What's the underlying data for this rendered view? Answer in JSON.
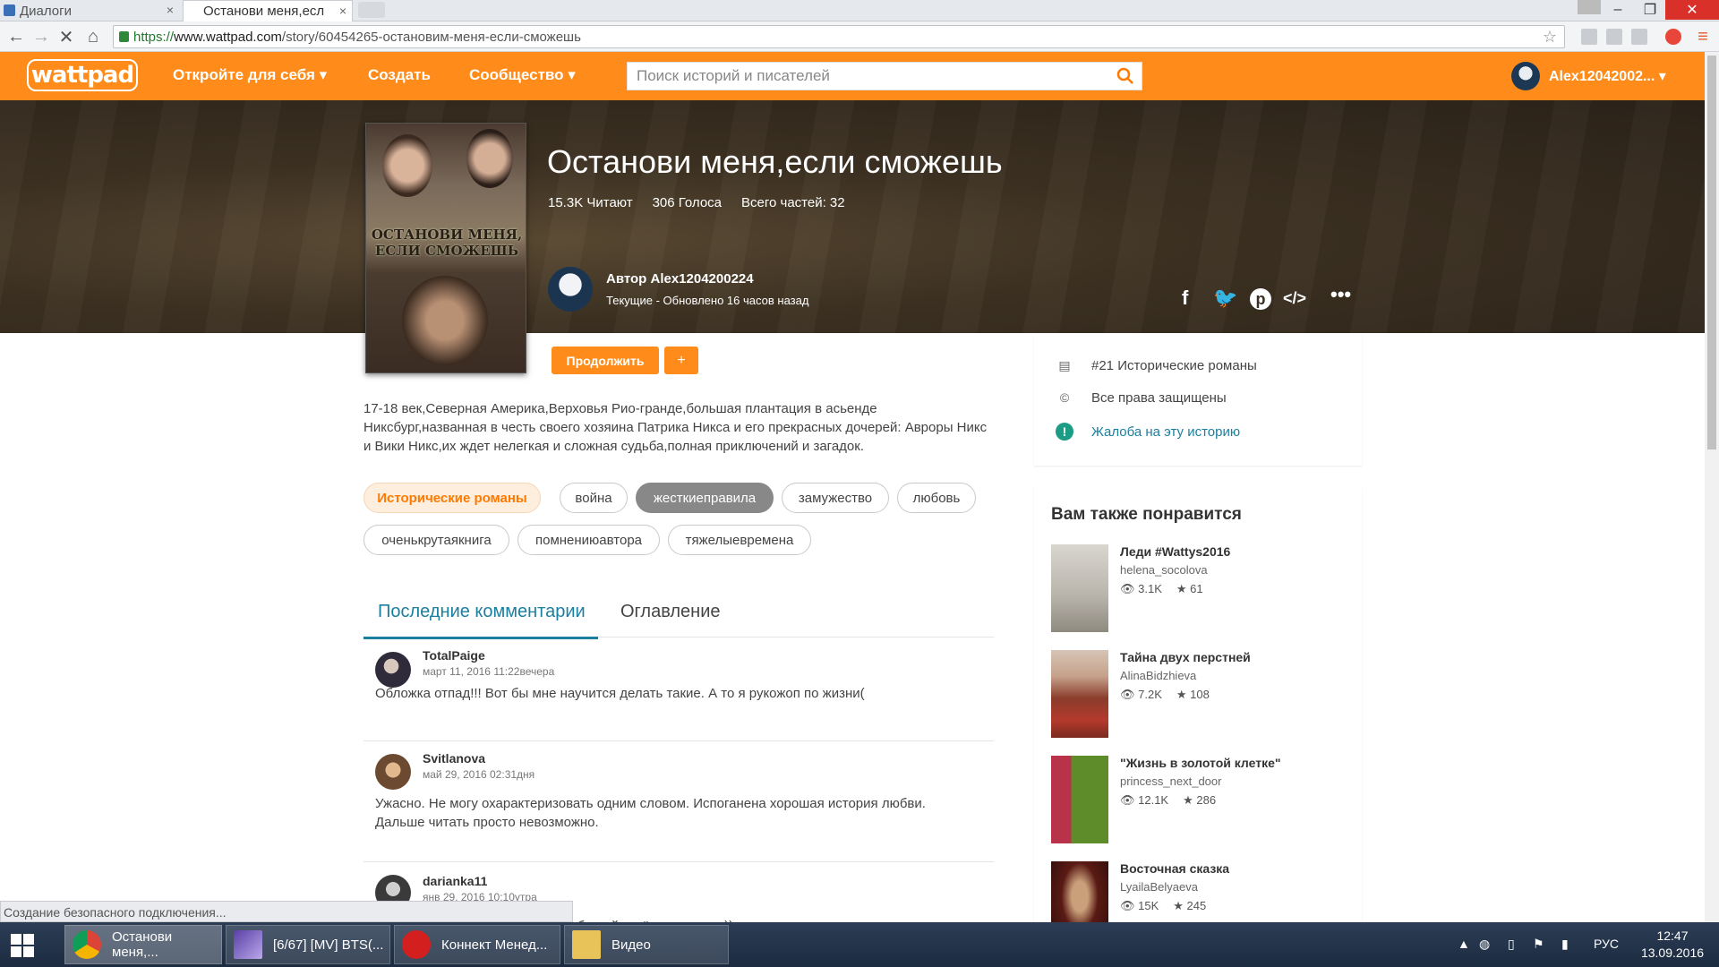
{
  "browser": {
    "tabs": [
      {
        "label": "Диалоги"
      },
      {
        "label": "Останови меня,есл"
      }
    ],
    "url_secure": "https://",
    "url_host": "www.wattpad.com",
    "url_path": "/story/60454265-остановим-меня-если-сможешь",
    "status_text": "Создание безопасного подключения..."
  },
  "nav": {
    "logo": "wattpad",
    "discover": "Откройте для себя ▾",
    "create": "Создать",
    "community": "Сообщество ▾",
    "search_placeholder": "Поиск историй и писателей",
    "username": "Alex12042002... ▾"
  },
  "story": {
    "cover_title": "ОСТАНОВИ МЕНЯ, ЕСЛИ СМОЖЕШЬ",
    "title": "Останови меня,если сможешь",
    "reads": "15.3K Читают",
    "votes": "306 Голоса",
    "parts": "Всего частей: 32",
    "author": "Автор Alex1204200224",
    "status": "Текущие - Обновлено 16 часов назад",
    "continue_label": "Продолжить",
    "add_label": "+",
    "description": "17-18 век,Северная Америка,Верховья Рио-гранде,большая плантация в асьенде Никсбург,названная в честь своего хозяина Патрика Никса и его прекрасных дочерей: Авроры Никс и Вики Никс,их ждет нелегкая и сложная судьба,полная приключений и загадок.",
    "tags": [
      "Исторические романы",
      "война",
      "жесткиеправила",
      "замужество",
      "любовь",
      "оченькрутаякнига",
      "помнениюавтора",
      "тяжелыевремена"
    ]
  },
  "social_icons": [
    "facebook-icon",
    "twitter-icon",
    "pinterest-icon",
    "embed-icon",
    "more-icon"
  ],
  "tabs": {
    "comments": "Последние комментарии",
    "toc": "Оглавление"
  },
  "comments": [
    {
      "name": "TotalPaige",
      "date": "март 11, 2016 11:22вечера",
      "text": "Обложка отпад!!! Вот бы мне научится делать такие. А то я рукожоп по жизни("
    },
    {
      "name": "Svitlanova",
      "date": "май 29, 2016 02:31дня",
      "text": "Ужасно. Не могу охарактеризовать одним словом. Испоганена хорошая история любви. Дальше читать просто невозможно."
    },
    {
      "name": "darianka11",
      "date": "янв 29, 2016 10:10утра",
      "text": "...ой. Любимый актёр и актриса:))"
    }
  ],
  "meta": {
    "rank": "#21 Исторические романы",
    "rights": "Все права защищены",
    "report": "Жалоба на эту историю"
  },
  "recs": {
    "title": "Вам также понравится",
    "items": [
      {
        "title": "Леди #Wattys2016",
        "author": "helena_socolova",
        "reads": "3.1K",
        "votes": "61"
      },
      {
        "title": "Тайна двух перстней",
        "author": "AlinaBidzhieva",
        "reads": "7.2K",
        "votes": "108"
      },
      {
        "title": "\"Жизнь в золотой клетке\"",
        "author": "princess_next_door",
        "reads": "12.1K",
        "votes": "286"
      },
      {
        "title": "Восточная сказка",
        "author": "LyailaBelyaeva",
        "reads": "15K",
        "votes": "245"
      }
    ]
  },
  "taskbar": {
    "items": [
      {
        "label": "Останови меня,..."
      },
      {
        "label": "[6/67] [MV] BTS(..."
      },
      {
        "label": "Коннект Менед..."
      },
      {
        "label": "Видео"
      }
    ],
    "lang": "РУС",
    "time": "12:47",
    "date": "13.09.2016"
  },
  "colors": {
    "brand": "#ff8c1a",
    "link": "#1b7f9f"
  }
}
